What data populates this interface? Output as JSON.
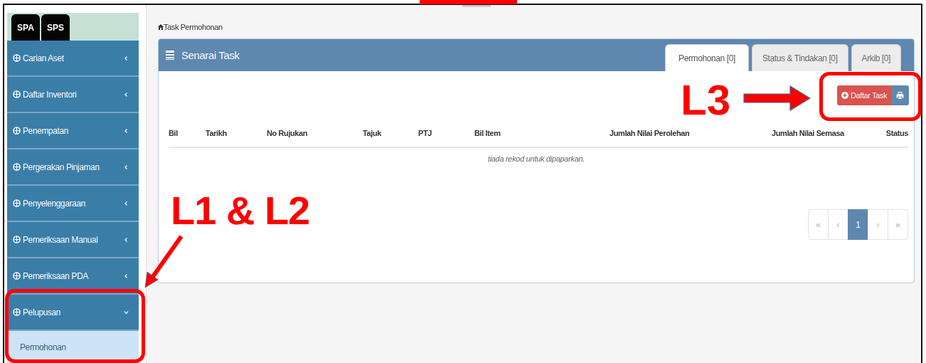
{
  "sidebar": {
    "tabs": [
      {
        "label": "SPA"
      },
      {
        "label": "SPS"
      }
    ],
    "items": [
      {
        "label": "Carian Aset",
        "expanded": false
      },
      {
        "label": "Daftar Inventori",
        "expanded": false
      },
      {
        "label": "Penempatan",
        "expanded": false
      },
      {
        "label": "Pergerakan Pinjaman",
        "expanded": false
      },
      {
        "label": "Penyelenggaraan",
        "expanded": false
      },
      {
        "label": "Pemeriksaan Manual",
        "expanded": false
      },
      {
        "label": "Pemeriksaan PDA",
        "expanded": false
      },
      {
        "label": "Pelupusan",
        "expanded": true,
        "children": [
          {
            "label": "Permohonan",
            "selected": true
          }
        ]
      }
    ]
  },
  "breadcrumb": "Task Permohonan",
  "panel": {
    "title": "Senarai Task",
    "tabs": [
      {
        "label": "Permohonan [0]",
        "selected": true
      },
      {
        "label": "Status & Tindakan [0]",
        "selected": false
      },
      {
        "label": "Arkib [0]",
        "selected": false
      }
    ],
    "buttons": [
      {
        "kind": "add",
        "label": "Daftar Task"
      },
      {
        "kind": "print"
      }
    ],
    "table": {
      "columns": [
        "Bil",
        "Tarikh",
        "No Rujukan",
        "Tajuk",
        "PTJ",
        "Bil Item",
        "Jumlah Nilai Perolehan",
        "Jumlah Nilai Semasa",
        "Status"
      ],
      "empty_message": "tiada rekod untuk dipaparkan."
    },
    "pagination": [
      {
        "label": "«",
        "selected": false
      },
      {
        "label": "‹",
        "selected": false
      },
      {
        "label": "1",
        "selected": true
      },
      {
        "label": "›",
        "selected": false
      },
      {
        "label": "»",
        "selected": false
      }
    ]
  },
  "annotations": [
    {
      "kind": "label",
      "text": "L1 & L2"
    },
    {
      "kind": "label",
      "text": "L3"
    }
  ]
}
